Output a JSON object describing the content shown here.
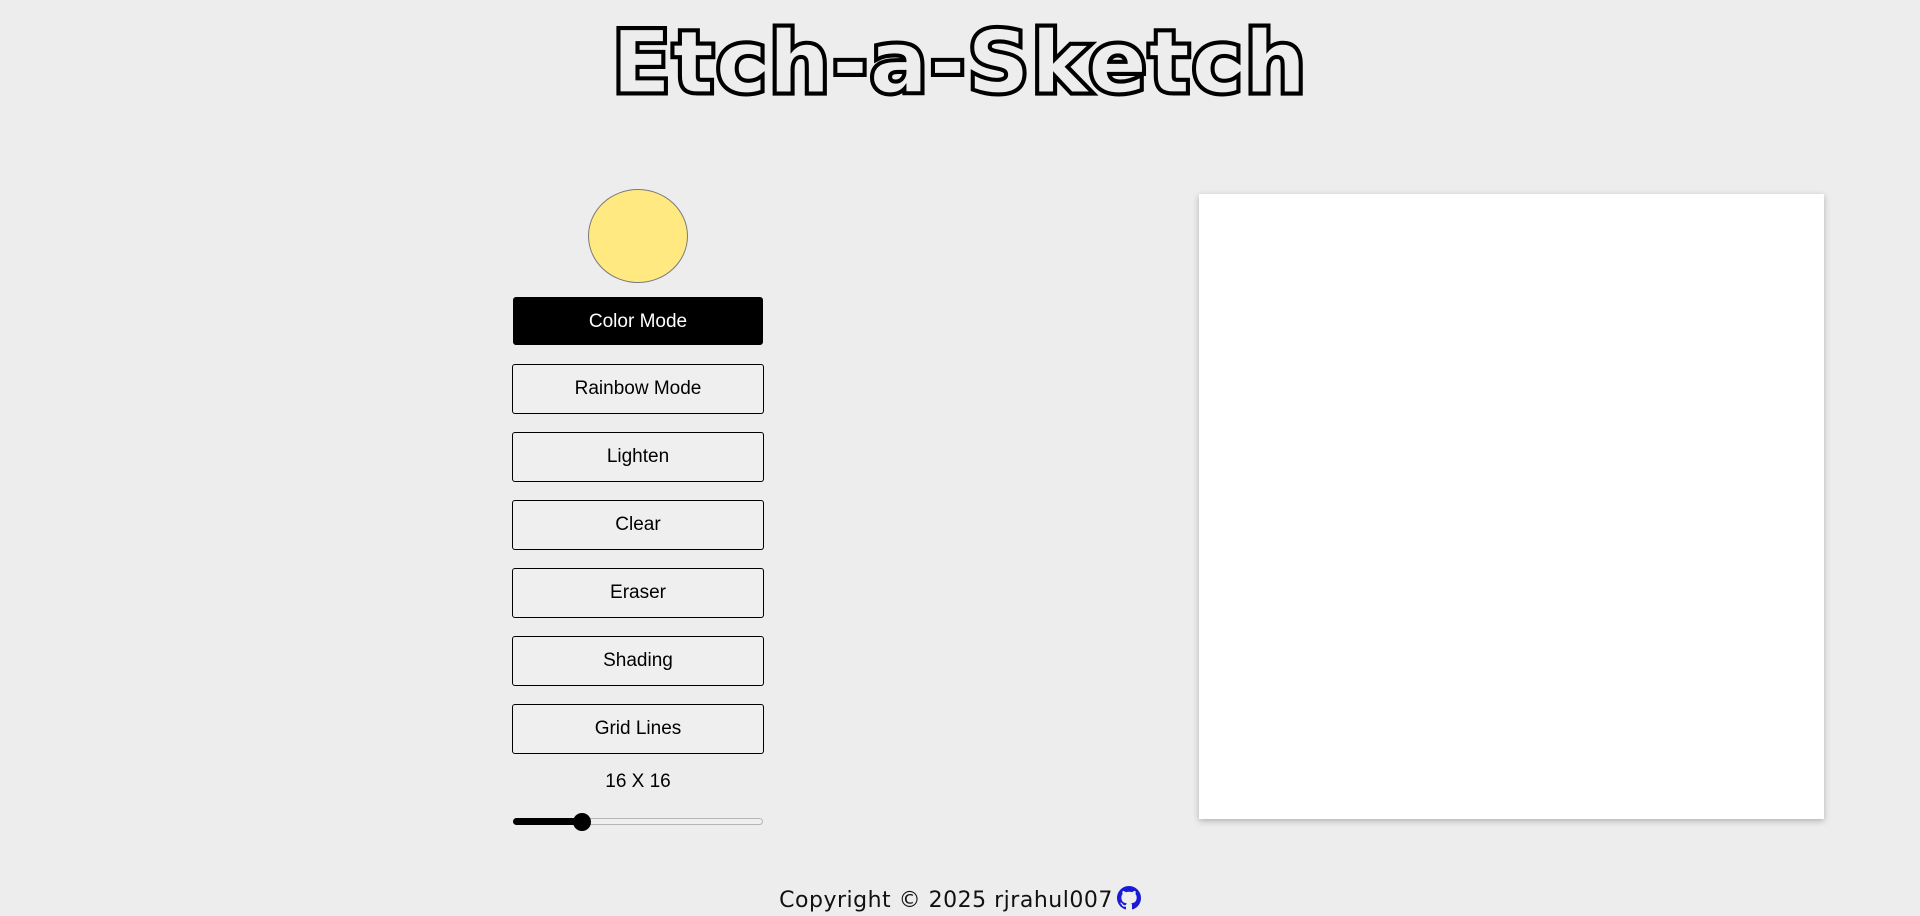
{
  "header": {
    "title": "Etch-a-Sketch"
  },
  "controls": {
    "current_color": "#ffe980",
    "buttons": [
      {
        "label": "Color Mode",
        "active": true
      },
      {
        "label": "Rainbow Mode",
        "active": false
      },
      {
        "label": "Lighten",
        "active": false
      },
      {
        "label": "Clear",
        "active": false
      },
      {
        "label": "Eraser",
        "active": false
      },
      {
        "label": "Shading",
        "active": false
      },
      {
        "label": "Grid Lines",
        "active": false
      }
    ],
    "grid_size_label": "16 X 16",
    "grid_size_value": 16,
    "grid_size_min": 1,
    "grid_size_max": 64
  },
  "canvas": {
    "background": "#ffffff"
  },
  "footer": {
    "copyright": "Copyright © 2025 rjrahul007",
    "icon": "github-icon",
    "icon_color": "#1a1ad6"
  }
}
